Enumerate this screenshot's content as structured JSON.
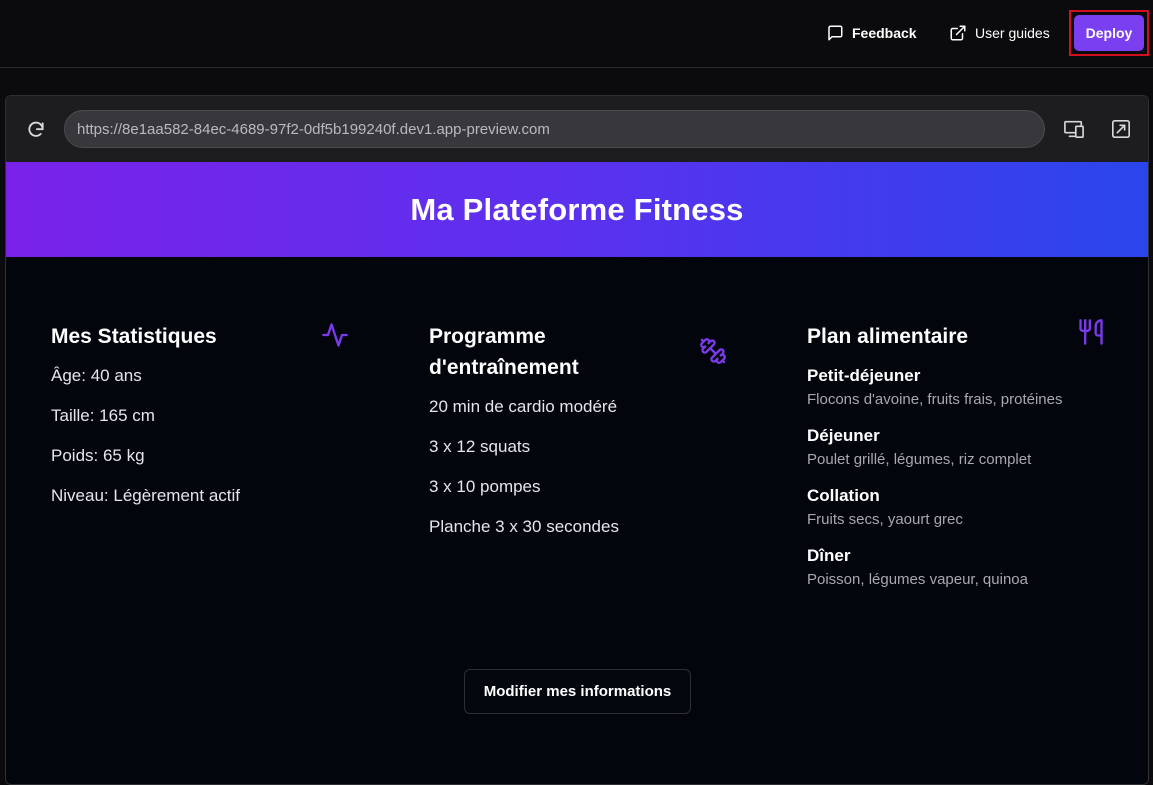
{
  "topbar": {
    "feedback_label": "Feedback",
    "guides_label": "User guides",
    "deploy_label": "Deploy"
  },
  "browser": {
    "url": "https://8e1aa582-84ec-4689-97f2-0df5b199240f.dev1.app-preview.com"
  },
  "app": {
    "title": "Ma Plateforme Fitness",
    "stats": {
      "heading": "Mes Statistiques",
      "items": [
        "Âge: 40 ans",
        "Taille: 165 cm",
        "Poids: 65 kg",
        "Niveau: Légèrement actif"
      ]
    },
    "program": {
      "heading": "Programme d'entraînement",
      "items": [
        "20 min de cardio modéré",
        "3 x 12 squats",
        "3 x 10 pompes",
        "Planche 3 x 30 secondes"
      ]
    },
    "meals": {
      "heading": "Plan alimentaire",
      "items": [
        {
          "name": "Petit-déjeuner",
          "desc": "Flocons d'avoine, fruits frais, protéines"
        },
        {
          "name": "Déjeuner",
          "desc": "Poulet grillé, légumes, riz complet"
        },
        {
          "name": "Collation",
          "desc": "Fruits secs, yaourt grec"
        },
        {
          "name": "Dîner",
          "desc": "Poisson, légumes vapeur, quinoa"
        }
      ]
    },
    "edit_label": "Modifier mes informations"
  },
  "colors": {
    "accent": "#7b3ff2",
    "icon": "#7c3aed",
    "highlight_border": "#d0101f"
  },
  "icons": [
    "message-square-icon",
    "external-link-icon",
    "reload-icon",
    "responsive-view-icon",
    "open-new-window-icon",
    "activity-icon",
    "dumbbell-icon",
    "utensils-icon"
  ]
}
